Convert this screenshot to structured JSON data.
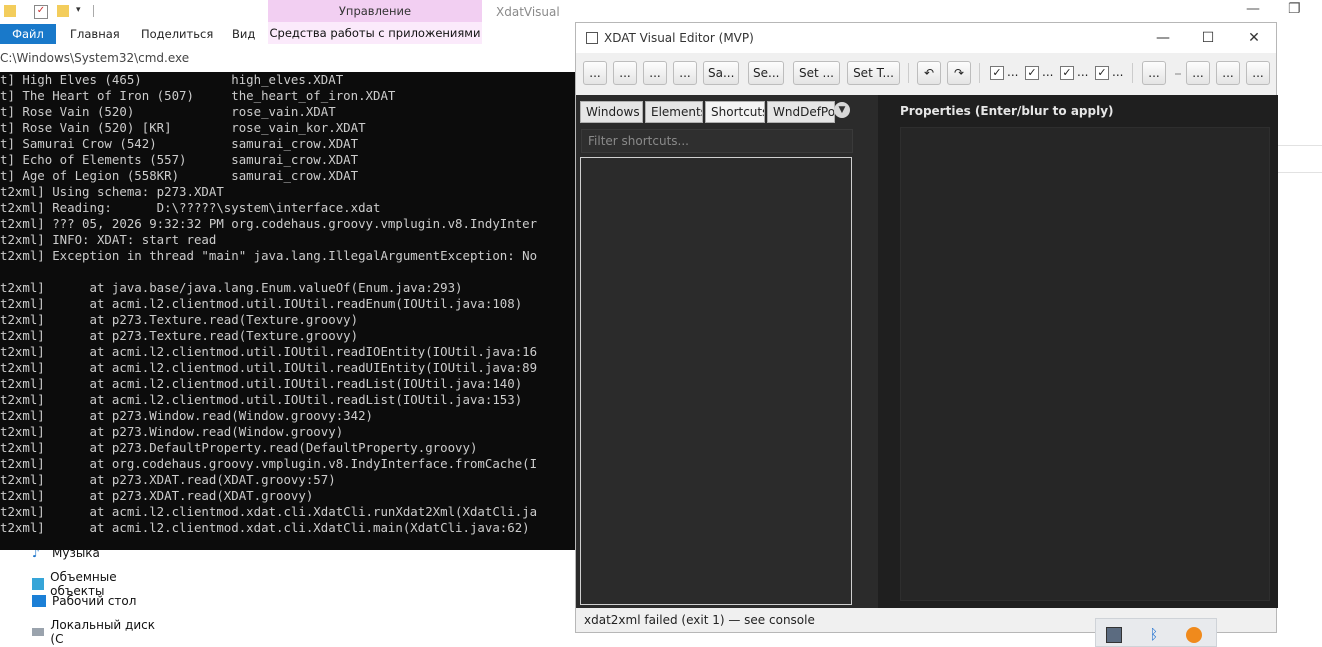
{
  "explorer": {
    "ribbon_tabs": [
      "Файл",
      "Главная",
      "Поделиться",
      "Вид"
    ],
    "manage_label": "Управление",
    "app_tools_label": "Средства работы с приложениями",
    "window_title": "XdatVisual",
    "nav_items": [
      "Музыка",
      "Объемные объекты",
      "Рабочий стол",
      "Локальный диск (С"
    ]
  },
  "cmd": {
    "title": "C:\\Windows\\System32\\cmd.exe",
    "lines": [
      "t] High Elves (465)            high_elves.XDAT",
      "t] The Heart of Iron (507)     the_heart_of_iron.XDAT",
      "t] Rose Vain (520)             rose_vain.XDAT",
      "t] Rose Vain (520) [KR]        rose_vain_kor.XDAT",
      "t] Samurai Crow (542)          samurai_crow.XDAT",
      "t] Echo of Elements (557)      samurai_crow.XDAT",
      "t] Age of Legion (558KR)       samurai_crow.XDAT",
      "t2xml] Using schema: p273.XDAT",
      "t2xml] Reading:      D:\\?????\\system\\interface.xdat",
      "t2xml] ??? 05, 2026 9:32:32 PM org.codehaus.groovy.vmplugin.v8.IndyInter",
      "t2xml] INFO: XDAT: start read",
      "t2xml] Exception in thread \"main\" java.lang.IllegalArgumentException: No",
      "",
      "t2xml]      at java.base/java.lang.Enum.valueOf(Enum.java:293)",
      "t2xml]      at acmi.l2.clientmod.util.IOUtil.readEnum(IOUtil.java:108)",
      "t2xml]      at p273.Texture.read(Texture.groovy)",
      "t2xml]      at p273.Texture.read(Texture.groovy)",
      "t2xml]      at acmi.l2.clientmod.util.IOUtil.readIOEntity(IOUtil.java:16",
      "t2xml]      at acmi.l2.clientmod.util.IOUtil.readUIEntity(IOUtil.java:89",
      "t2xml]      at acmi.l2.clientmod.util.IOUtil.readList(IOUtil.java:140)",
      "t2xml]      at acmi.l2.clientmod.util.IOUtil.readList(IOUtil.java:153)",
      "t2xml]      at p273.Window.read(Window.groovy:342)",
      "t2xml]      at p273.Window.read(Window.groovy)",
      "t2xml]      at p273.DefaultProperty.read(DefaultProperty.groovy)",
      "t2xml]      at org.codehaus.groovy.vmplugin.v8.IndyInterface.fromCache(I",
      "t2xml]      at p273.XDAT.read(XDAT.groovy:57)",
      "t2xml]      at p273.XDAT.read(XDAT.groovy)",
      "t2xml]      at acmi.l2.clientmod.xdat.cli.XdatCli.runXdat2Xml(XdatCli.ja",
      "t2xml]      at acmi.l2.clientmod.xdat.cli.XdatCli.main(XdatCli.java:62)"
    ]
  },
  "editor": {
    "title": "XDAT Visual Editor (MVP)",
    "toolbar_buttons": [
      "...",
      "...",
      "...",
      "...",
      "Sa...",
      "Se...",
      "Set ...",
      "Set T..."
    ],
    "undo_icon": "undo-icon",
    "redo_icon": "redo-icon",
    "checkboxes": [
      {
        "label": "...",
        "checked": true
      },
      {
        "label": "...",
        "checked": true
      },
      {
        "label": "...",
        "checked": true
      },
      {
        "label": "...",
        "checked": true
      }
    ],
    "right_buttons": [
      "...",
      "...",
      "...",
      "..."
    ],
    "tabs": [
      "Windows",
      "Elements",
      "Shortcuts",
      "WndDefPos"
    ],
    "active_tab": "Shortcuts",
    "filter_placeholder": "Filter shortcuts...",
    "properties_title": "Properties (Enter/blur to apply)",
    "status": "xdat2xml failed (exit 1) — see console"
  }
}
